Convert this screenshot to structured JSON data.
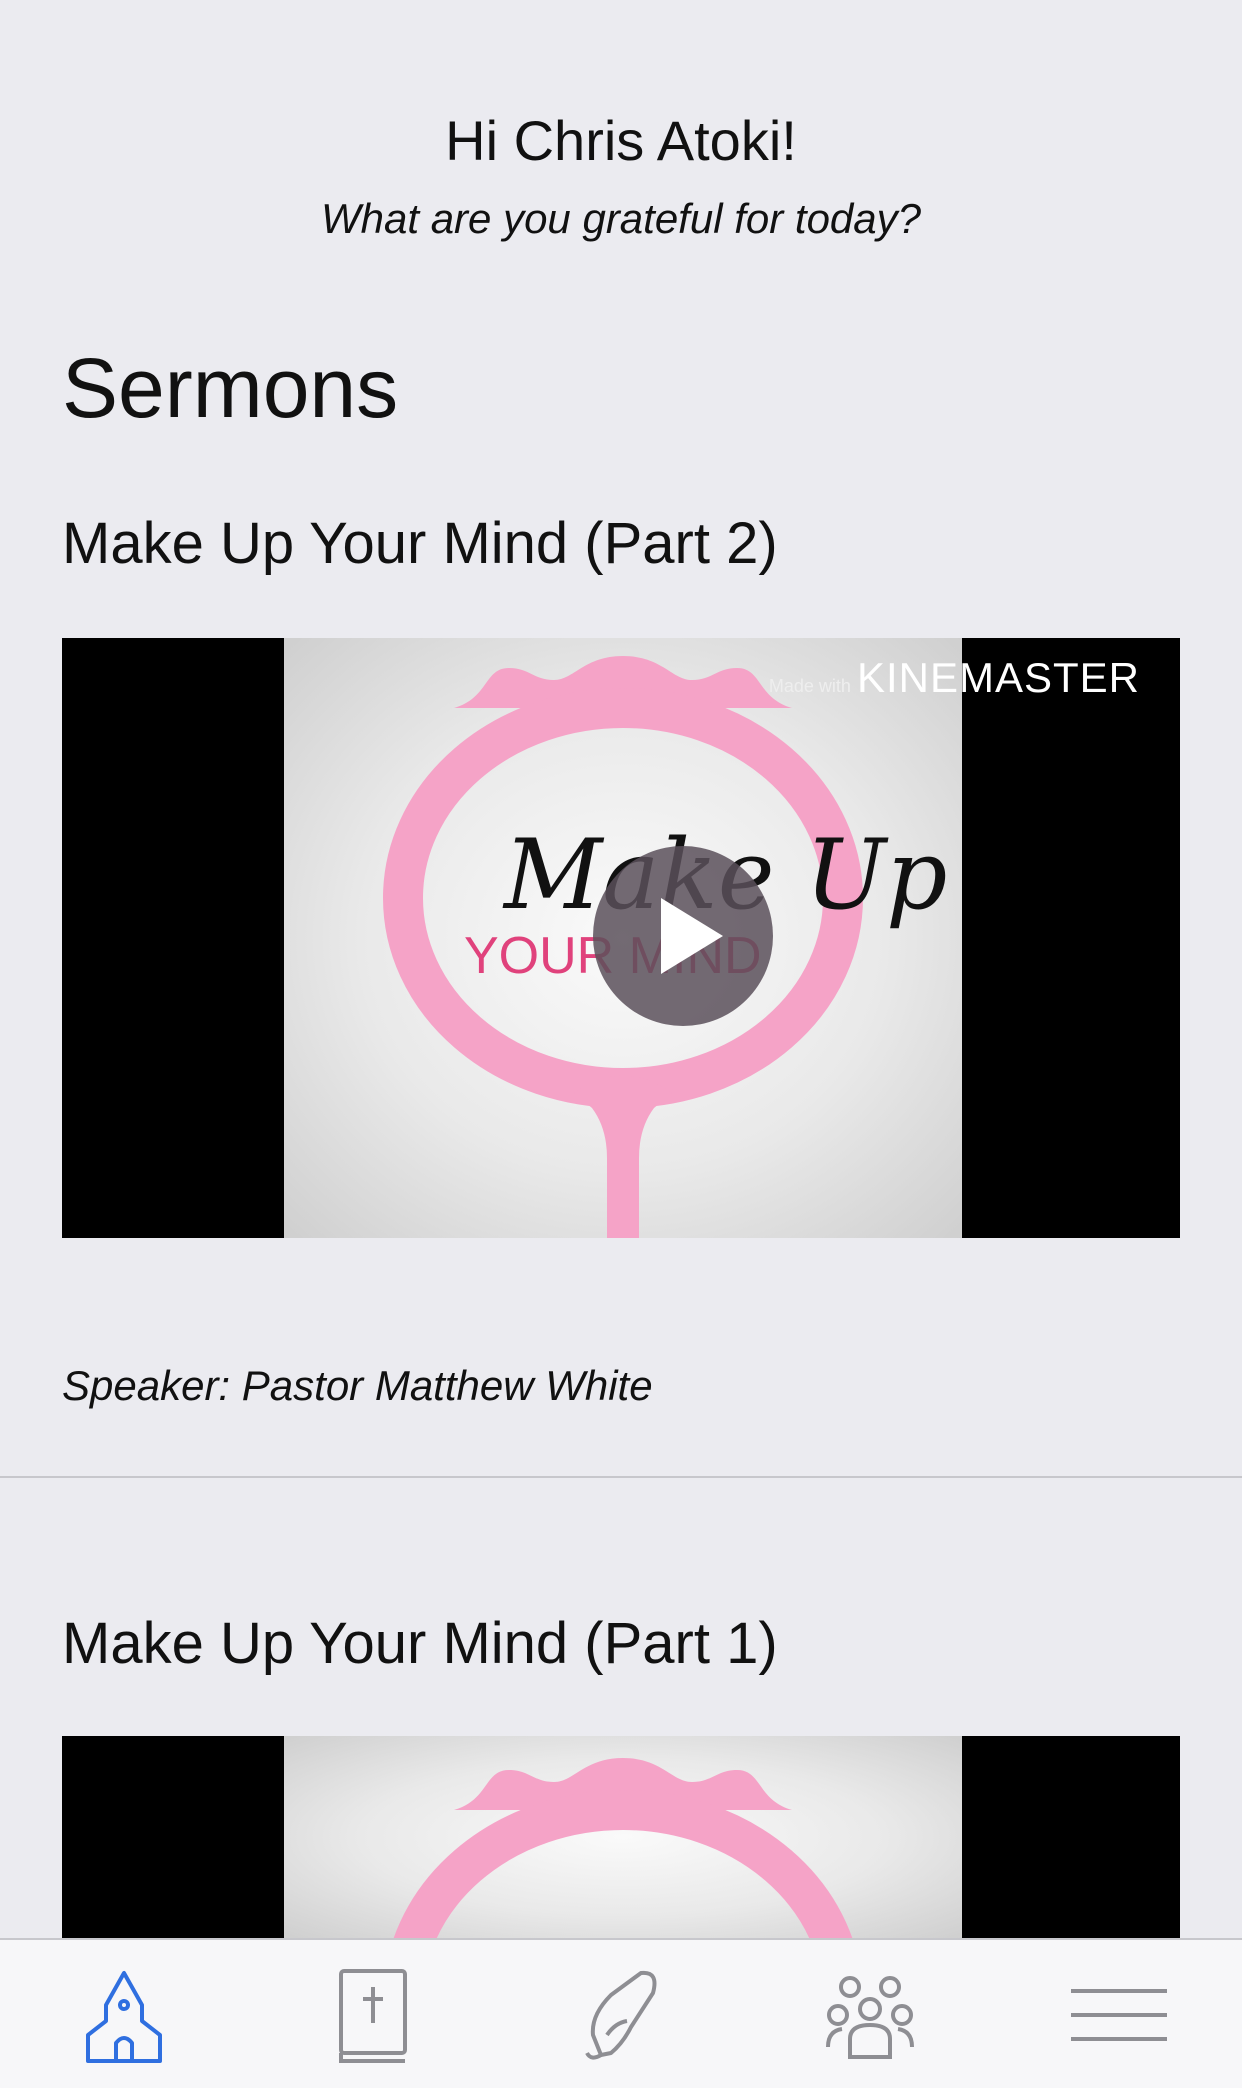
{
  "header": {
    "greeting": "Hi Chris Atoki!",
    "prompt": "What are you grateful for today?"
  },
  "sermons": {
    "section_title": "Sermons",
    "items": [
      {
        "title": "Make Up Your Mind (Part 2)",
        "watermark_prefix": "Made with",
        "watermark": "KINEMASTER",
        "thumb_script": "Make Up",
        "thumb_sub": "YOUR MIND",
        "speaker": "Speaker: Pastor Matthew White"
      },
      {
        "title": "Make Up Your Mind (Part 1)"
      }
    ]
  },
  "tabbar": {
    "active_color": "#2f6fe0",
    "inactive_color": "#8e8e93",
    "items": [
      {
        "icon": "church-icon",
        "active": true
      },
      {
        "icon": "bible-icon",
        "active": false
      },
      {
        "icon": "prayer-hands-icon",
        "active": false
      },
      {
        "icon": "group-icon",
        "active": false
      },
      {
        "icon": "menu-icon",
        "active": false
      }
    ]
  }
}
